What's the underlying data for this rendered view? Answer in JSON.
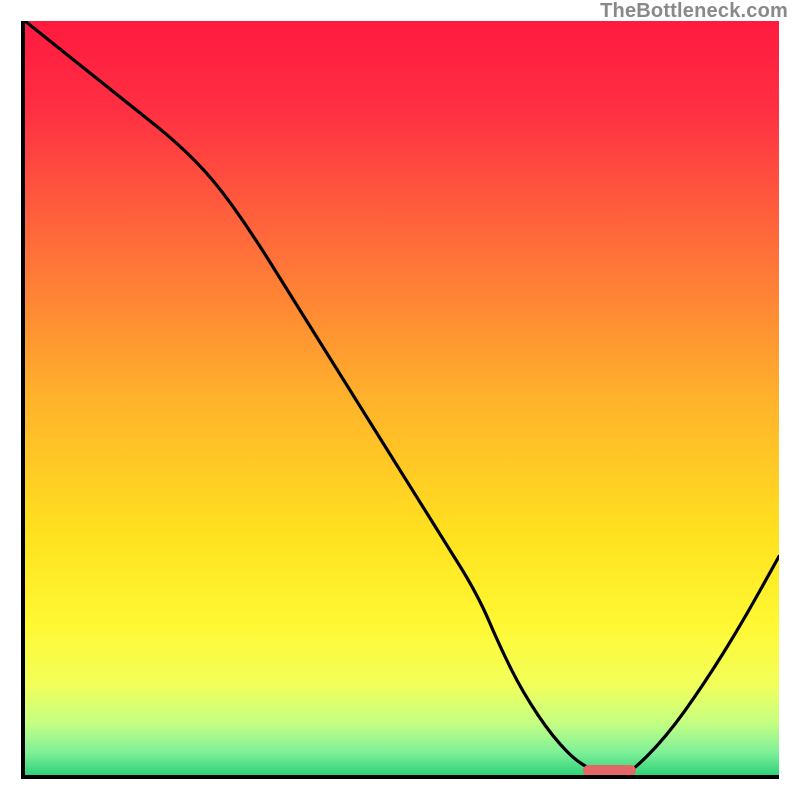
{
  "watermark": "TheBottleneck.com",
  "chart_data": {
    "type": "line",
    "title": "",
    "xlabel": "",
    "ylabel": "",
    "xlim": [
      0,
      100
    ],
    "ylim": [
      0,
      100
    ],
    "grid": false,
    "background_gradient": {
      "stops": [
        {
          "offset": 0.0,
          "color": "#ff1a3f"
        },
        {
          "offset": 0.12,
          "color": "#ff3043"
        },
        {
          "offset": 0.3,
          "color": "#ff6e3a"
        },
        {
          "offset": 0.5,
          "color": "#ffb22b"
        },
        {
          "offset": 0.68,
          "color": "#ffe11f"
        },
        {
          "offset": 0.8,
          "color": "#fff833"
        },
        {
          "offset": 0.88,
          "color": "#f2ff5a"
        },
        {
          "offset": 0.93,
          "color": "#c6ff82"
        },
        {
          "offset": 0.97,
          "color": "#7ef098"
        },
        {
          "offset": 1.0,
          "color": "#2fd37a"
        }
      ]
    },
    "series": [
      {
        "name": "bottleneck-curve",
        "type": "line",
        "color": "#000000",
        "x": [
          0,
          5,
          10,
          15,
          20,
          25,
          30,
          35,
          40,
          45,
          50,
          55,
          60,
          63,
          66,
          70,
          74,
          78,
          80,
          85,
          90,
          95,
          100
        ],
        "y": [
          100,
          96,
          92,
          88,
          84,
          79,
          72,
          64,
          56,
          48,
          40,
          32,
          24,
          17,
          11,
          5,
          1,
          0,
          0,
          5,
          12,
          20,
          29
        ]
      }
    ],
    "marker": {
      "name": "optimal-range",
      "color": "#e46767",
      "x_start": 74,
      "x_end": 81,
      "y": 0.5
    }
  }
}
